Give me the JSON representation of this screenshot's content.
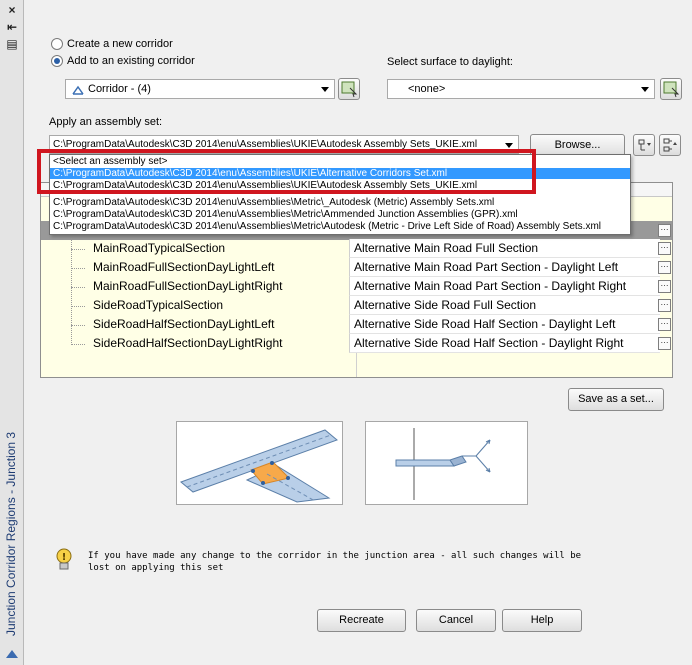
{
  "palette": {
    "close_glyph": "×",
    "pin_glyph": "⇤",
    "props_glyph": "▤",
    "title": "Junction Corridor Regions - Junction 3"
  },
  "corridor": {
    "option_create": "Create a new corridor",
    "option_add": "Add to an existing corridor",
    "selected_option": "add",
    "corridor_value": "Corridor - (4)"
  },
  "daylight": {
    "label": "Select surface to daylight:",
    "value": "<none>"
  },
  "assembly": {
    "label": "Apply an assembly set:",
    "value": "C:\\ProgramData\\Autodesk\\C3D 2014\\enu\\Assemblies\\UKIE\\Autodesk Assembly Sets_UKIE.xml",
    "browse": "Browse...",
    "options": [
      "<Select an assembly set>",
      "C:\\ProgramData\\Autodesk\\C3D 2014\\enu\\Assemblies\\UKIE\\Alternative Corridors Set.xml",
      "C:\\ProgramData\\Autodesk\\C3D 2014\\enu\\Assemblies\\UKIE\\Autodesk Assembly Sets_UKIE.xml",
      "C:\\ProgramData\\Autodesk\\C3D 2014\\enu\\Assemblies\\Metric\\_Autodesk (Metric) Assembly Sets.xml",
      "C:\\ProgramData\\Autodesk\\C3D 2014\\enu\\Assemblies\\Metric\\Ammended Junction Assemblies (GPR).xml",
      "C:\\ProgramData\\Autodesk\\C3D 2014\\enu\\Assemblies\\Metric\\Autodesk (Metric - Drive Left Side of Road) Assembly Sets.xml"
    ],
    "highlighted_index": 1
  },
  "grid": {
    "rows": [
      {
        "name": "MainRoadTypicalSection",
        "value": "Alternative Main Road Full Section"
      },
      {
        "name": "MainRoadFullSectionDayLightLeft",
        "value": "Alternative Main Road Part Section - Daylight Left"
      },
      {
        "name": "MainRoadFullSectionDayLightRight",
        "value": "Alternative Main Road Part Section - Daylight Right"
      },
      {
        "name": "SideRoadTypicalSection",
        "value": "Alternative Side Road Full Section"
      },
      {
        "name": "SideRoadHalfSectionDayLightLeft",
        "value": "Alternative Side Road Half Section - Daylight Left"
      },
      {
        "name": "SideRoadHalfSectionDayLightRight",
        "value": "Alternative Side Road Half Section - Daylight Right"
      }
    ],
    "ellipsis": "···"
  },
  "save_set": "Save as a set...",
  "warning": {
    "text": "If you have made any change to the corridor in the junction area - all such changes will be lost on applying this set"
  },
  "buttons": {
    "recreate": "Recreate",
    "cancel": "Cancel",
    "help": "Help"
  },
  "colors": {
    "highlight": "#3399ff",
    "callout": "#d0161f",
    "grid_bg": "#ffffe6",
    "junction_fill": "#f7a94a",
    "road_fill": "#b9cfe8"
  }
}
